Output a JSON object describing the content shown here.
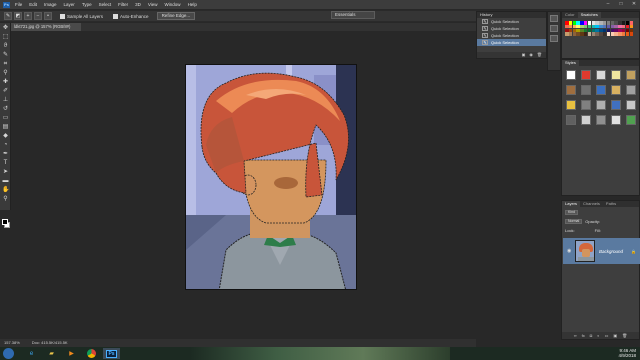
{
  "app": {
    "logo": "Ps"
  },
  "menubar": {
    "items": [
      "File",
      "Edit",
      "Image",
      "Layer",
      "Type",
      "Select",
      "Filter",
      "3D",
      "View",
      "Window",
      "Help"
    ],
    "window_controls": [
      "minimize-icon",
      "maximize-icon",
      "close-icon"
    ]
  },
  "options_bar": {
    "sample_all_layers_label": "Sample All Layers",
    "auto_enhance_label": "Auto-Enhance",
    "refine_edge_label": "Refine Edge...",
    "workspace_value": "Essentials"
  },
  "document": {
    "tab_label": "ldkt721.jpg @ 157% (RGB/8#)"
  },
  "status_bar": {
    "zoom": "157.38%",
    "doc_size": "Doc: 415.5K/415.5K"
  },
  "history_panel": {
    "title": "History",
    "items": [
      {
        "label": "Quick Selection",
        "active": false
      },
      {
        "label": "Quick Selection",
        "active": false
      },
      {
        "label": "Quick Selection",
        "active": false
      },
      {
        "label": "Quick Selection",
        "active": true
      }
    ]
  },
  "swatches_panel": {
    "tabs": [
      "Color",
      "Swatches"
    ],
    "active_tab": "Swatches",
    "colors": [
      "#ff0000",
      "#ffff00",
      "#00ff00",
      "#00ffff",
      "#0000ff",
      "#ff00ff",
      "#ffffff",
      "#e6e6e6",
      "#cccccc",
      "#b3b3b3",
      "#999999",
      "#808080",
      "#666666",
      "#4d4d4d",
      "#333333",
      "#1a1a1a",
      "#000000",
      "#ff6666",
      "#f26c4f",
      "#f68e56",
      "#fbaf5d",
      "#fff467",
      "#acd372",
      "#7cc576",
      "#3bb878",
      "#1abbb4",
      "#00bff3",
      "#438ccb",
      "#5574b9",
      "#605ca8",
      "#855fa8",
      "#a763a8",
      "#f06ea9",
      "#f26d7d",
      "#ed1c24",
      "#f7941d",
      "#9e0b0f",
      "#a0410d",
      "#a36209",
      "#aba000",
      "#598527",
      "#1a7b30",
      "#007236",
      "#00746b",
      "#0076a3",
      "#004b80",
      "#003471",
      "#1b1464",
      "#440e62",
      "#630460",
      "#9e005d",
      "#9e0039",
      "#790000",
      "#7b2e00",
      "#c69c6d",
      "#a67c52",
      "#8c6239",
      "#754c24",
      "#603913",
      "#3c2415",
      "#c7b299",
      "#998675",
      "#736357",
      "#534741",
      "#37302d",
      "#fbe4d5",
      "#f9cbb0",
      "#f7b08c",
      "#f49564",
      "#f17a3e",
      "#ec5b13",
      "#d9470b"
    ]
  },
  "styles_panel": {
    "title": "Styles",
    "tiles": [
      "#ffffff",
      "#e03a2e",
      "#d8d8d8",
      "#f0e6a0",
      "#c0a060",
      "#9f6e3f",
      "#707070",
      "#3a6fc0",
      "#d8b060",
      "#a0a0a0",
      "#e8c040",
      "#808080",
      "#b0b0b0",
      "#4070c0",
      "#c8c8c8",
      "#606060",
      "#d0d0d0",
      "#909090",
      "#e0e0e0",
      "#50a050"
    ]
  },
  "layers_panel": {
    "tabs": [
      "Layers",
      "Channels",
      "Paths"
    ],
    "active_tab": "Layers",
    "kind_filter": "Kind",
    "blend_mode": "Normal",
    "opacity_label": "Opacity:",
    "lock_label": "Lock:",
    "fill_label": "Fill:",
    "layers": [
      {
        "name": "Background",
        "locked": true,
        "visible": true
      }
    ],
    "footer_icons": [
      "link-icon",
      "fx-icon",
      "mask-icon",
      "adjustment-icon",
      "folder-icon",
      "new-layer-icon",
      "trash-icon"
    ]
  },
  "taskbar": {
    "apps": [
      "start-orb",
      "internet-explorer",
      "file-explorer",
      "media-player",
      "chrome",
      "photoshop"
    ],
    "time": "9:46 AM",
    "date": "4/9/2018"
  }
}
